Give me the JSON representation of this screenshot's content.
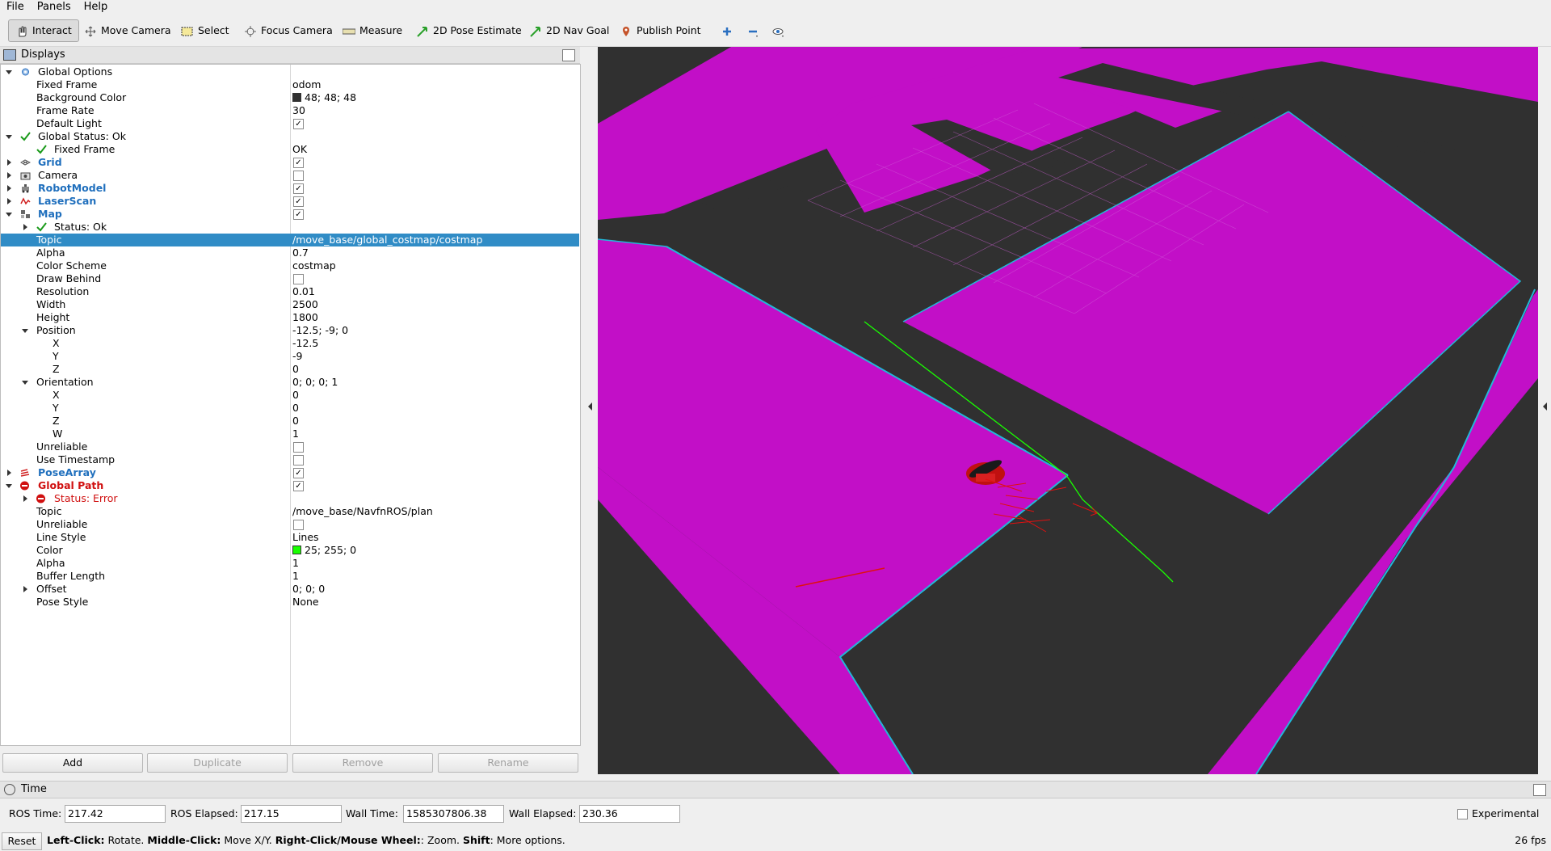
{
  "menu": [
    "File",
    "Panels",
    "Help"
  ],
  "toolbar": {
    "interact": "Interact",
    "move_camera": "Move Camera",
    "select": "Select",
    "focus_camera": "Focus Camera",
    "measure": "Measure",
    "pose_estimate": "2D Pose Estimate",
    "nav_goal": "2D Nav Goal",
    "publish_point": "Publish Point"
  },
  "displays": {
    "title": "Displays",
    "rows": {
      "global_options": "Global Options",
      "fixed_frame": {
        "label": "Fixed Frame",
        "value": "odom"
      },
      "background_color": {
        "label": "Background Color",
        "value": "48; 48; 48",
        "color": "#303030"
      },
      "frame_rate": {
        "label": "Frame Rate",
        "value": "30"
      },
      "default_light": {
        "label": "Default Light"
      },
      "global_status": "Global Status: Ok",
      "status_fixed_frame": {
        "label": "Fixed Frame",
        "value": "OK"
      },
      "grid": "Grid",
      "camera": "Camera",
      "robot_model": "RobotModel",
      "laser_scan": "LaserScan",
      "map": "Map",
      "map_status": "Status: Ok",
      "map_topic": {
        "label": "Topic",
        "value": "/move_base/global_costmap/costmap"
      },
      "map_alpha": {
        "label": "Alpha",
        "value": "0.7"
      },
      "color_scheme": {
        "label": "Color Scheme",
        "value": "costmap"
      },
      "draw_behind": {
        "label": "Draw Behind"
      },
      "resolution": {
        "label": "Resolution",
        "value": "0.01"
      },
      "width": {
        "label": "Width",
        "value": "2500"
      },
      "height": {
        "label": "Height",
        "value": "1800"
      },
      "position": {
        "label": "Position",
        "value": "-12.5; -9; 0"
      },
      "pos_x": {
        "label": "X",
        "value": "-12.5"
      },
      "pos_y": {
        "label": "Y",
        "value": "-9"
      },
      "pos_z": {
        "label": "Z",
        "value": "0"
      },
      "orientation": {
        "label": "Orientation",
        "value": "0; 0; 0; 1"
      },
      "ori_x": {
        "label": "X",
        "value": "0"
      },
      "ori_y": {
        "label": "Y",
        "value": "0"
      },
      "ori_z": {
        "label": "Z",
        "value": "0"
      },
      "ori_w": {
        "label": "W",
        "value": "1"
      },
      "unreliable": {
        "label": "Unreliable"
      },
      "use_timestamp": {
        "label": "Use Timestamp"
      },
      "pose_array": "PoseArray",
      "global_path": "Global Path",
      "path_status": "Status: Error",
      "path_topic": {
        "label": "Topic",
        "value": "/move_base/NavfnROS/plan"
      },
      "path_unreliable": {
        "label": "Unreliable"
      },
      "line_style": {
        "label": "Line Style",
        "value": "Lines"
      },
      "path_color": {
        "label": "Color",
        "value": "25; 255; 0",
        "color": "#19ff00"
      },
      "path_alpha": {
        "label": "Alpha",
        "value": "1"
      },
      "buffer_length": {
        "label": "Buffer Length",
        "value": "1"
      },
      "offset": {
        "label": "Offset",
        "value": "0; 0; 0"
      },
      "pose_style": {
        "label": "Pose Style",
        "value": "None"
      }
    },
    "buttons": {
      "add": "Add",
      "duplicate": "Duplicate",
      "remove": "Remove",
      "rename": "Rename"
    }
  },
  "time": {
    "title": "Time",
    "ros_time_label": "ROS Time:",
    "ros_time": "217.42",
    "ros_elapsed_label": "ROS Elapsed:",
    "ros_elapsed": "217.15",
    "wall_time_label": "Wall Time:",
    "wall_time": "1585307806.38",
    "wall_elapsed_label": "Wall Elapsed:",
    "wall_elapsed": "230.36",
    "experimental": "Experimental"
  },
  "status": {
    "reset": "Reset",
    "left_click": "Left-Click:",
    "left_click_action": " Rotate. ",
    "middle_click": "Middle-Click:",
    "middle_click_action": " Move X/Y. ",
    "right_click": "Right-Click/Mouse Wheel:",
    "right_click_action": ": Zoom. ",
    "shift": "Shift",
    "shift_action": ": More options.",
    "fps": "26 fps"
  },
  "colors": {
    "costmap": "#c20fc7",
    "inflation_edge": "#22b8d8",
    "background": "#303030",
    "path": "#19ff00",
    "pose": "#e01010"
  }
}
